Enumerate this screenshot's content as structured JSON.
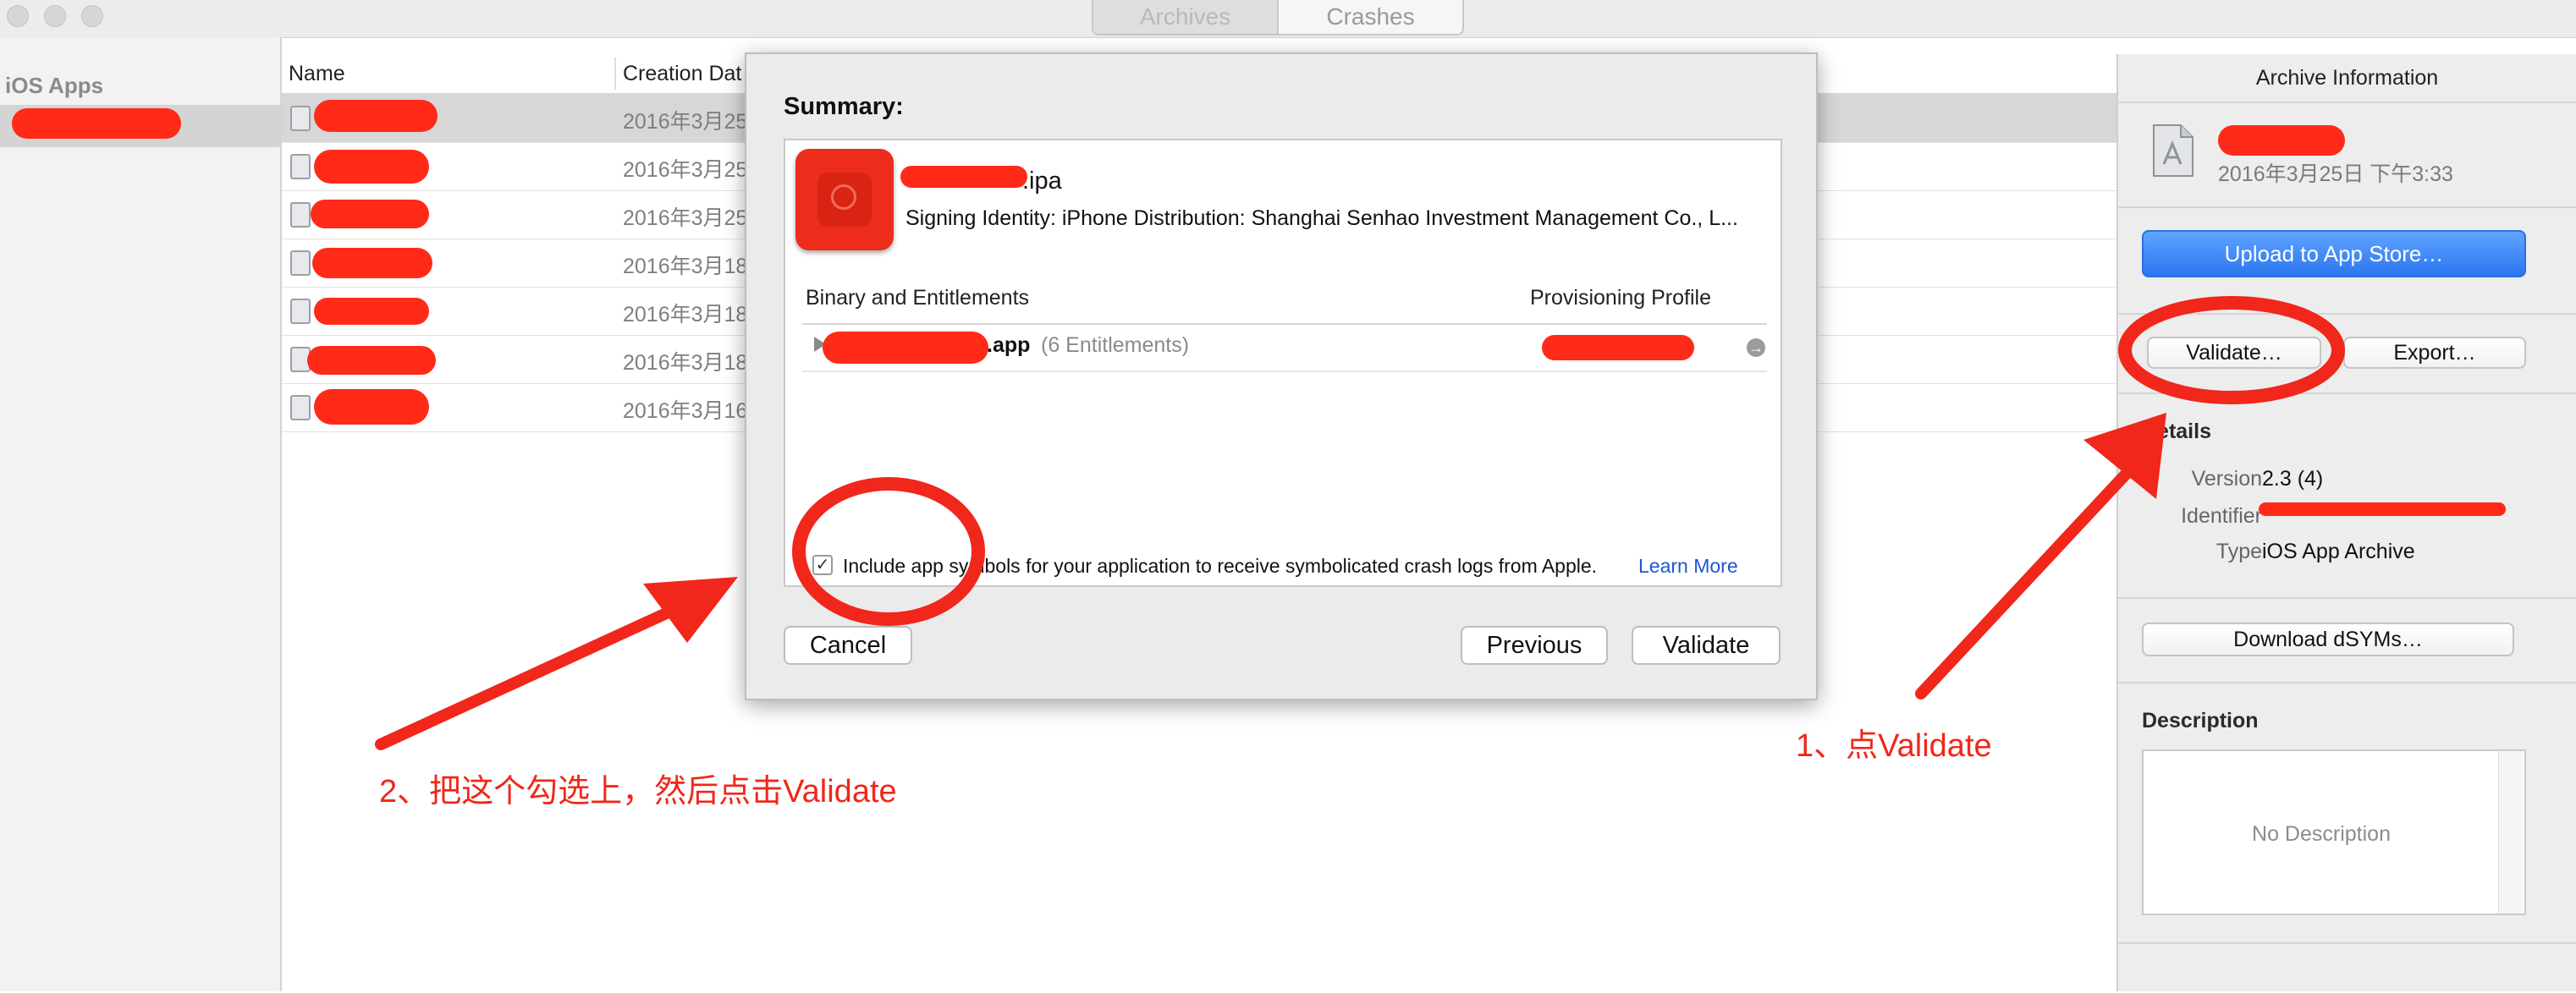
{
  "window": {
    "segments": [
      "Archives",
      "Crashes"
    ],
    "selected_segment": "Archives"
  },
  "sidebar": {
    "heading": "iOS Apps"
  },
  "table": {
    "columns": [
      "Name",
      "Creation Dat"
    ],
    "rows": [
      {
        "date": "2016年3月25"
      },
      {
        "date": "2016年3月25"
      },
      {
        "date": "2016年3月25"
      },
      {
        "date": "2016年3月18"
      },
      {
        "date": "2016年3月18"
      },
      {
        "date": "2016年3月18"
      },
      {
        "date": "2016年3月16"
      }
    ]
  },
  "dialog": {
    "title": "Summary:",
    "ipa_name": ".ipa",
    "signing_identity": "Signing Identity: iPhone Distribution: Shanghai Senhao Investment Management Co., L...",
    "col_binary": "Binary and Entitlements",
    "col_profile": "Provisioning Profile",
    "app_name": ".app",
    "entitlements": "(6 Entitlements)",
    "checkbox_label": "Include app symbols for your application to receive symbolicated crash logs from Apple.",
    "checkbox_checked": true,
    "learn_more": "Learn More",
    "cancel": "Cancel",
    "previous": "Previous",
    "validate": "Validate"
  },
  "inspector": {
    "title": "Archive Information",
    "archive_date": "2016年3月25日 下午3:33",
    "upload_button": "Upload to App Store…",
    "validate_button": "Validate…",
    "export_button": "Export…",
    "details_heading": "Details",
    "version_label": "Version",
    "version_value": "2.3 (4)",
    "identifier_label": "Identifier",
    "type_label": "Type",
    "type_value": "iOS App Archive",
    "dsym_button": "Download dSYMs…",
    "description_heading": "Description",
    "description_placeholder": "No Description"
  },
  "annotations": {
    "step1": "1、点Validate",
    "step2": "2、把这个勾选上，然后点击Validate",
    "color": "#f0271a"
  },
  "colors": {
    "accent_blue": "#2b76f0",
    "link_blue": "#1a56d6",
    "redaction_red": "#ff2a18"
  }
}
